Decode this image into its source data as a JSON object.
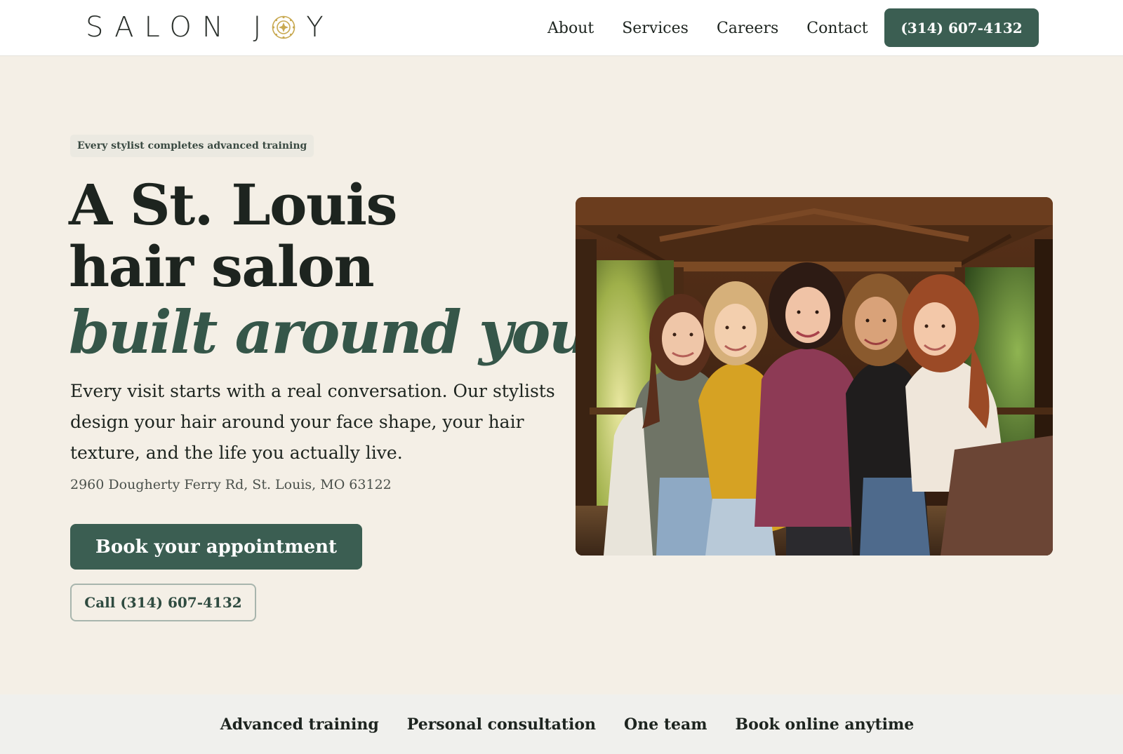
{
  "brand": {
    "name_start": "SALON J",
    "name_end": "Y",
    "mark_icon": "sun-flower-icon",
    "accent_color": "#3b5e52",
    "logo_gold": "#c8a951"
  },
  "nav": {
    "items": [
      "About",
      "Services",
      "Careers",
      "Contact"
    ],
    "phone_button": "(314) 607-4132"
  },
  "hero": {
    "badge": "Every stylist completes advanced training",
    "headline_line1": "A St. Louis",
    "headline_line2": "hair salon",
    "headline_accent": "built around you.",
    "intro": "Every visit starts with a real conversation. Our stylists design your hair around your face shape, your hair texture, and the life you actually live.",
    "address": "2960 Dougherty Ferry Rd, St. Louis, MO 63122",
    "book_button": "Book your appointment",
    "call_button": "Call (314) 607-4132"
  },
  "photo": {
    "subject": "five stylists smiling together under a wooden covered bridge"
  },
  "features": [
    "Advanced training",
    "Personal consultation",
    "One team",
    "Book online anytime"
  ]
}
